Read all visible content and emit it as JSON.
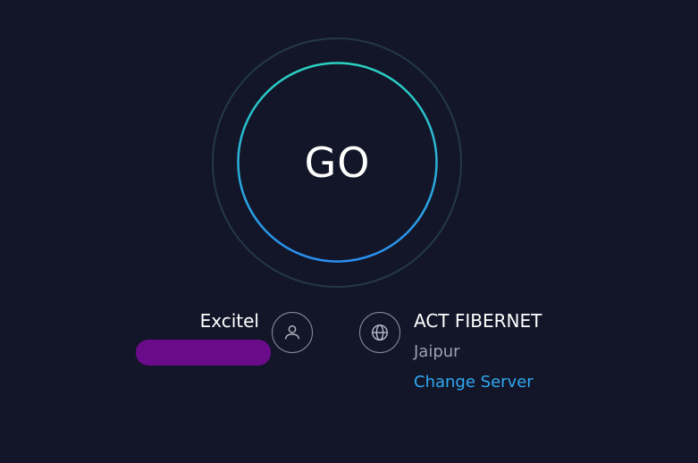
{
  "go_button": {
    "label": "GO"
  },
  "client": {
    "isp_name": "Excitel",
    "ip_redacted": true,
    "icon": "user-icon"
  },
  "server": {
    "name": "ACT FIBERNET",
    "location": "Jaipur",
    "change_label": "Change Server",
    "icon": "globe-icon"
  },
  "colors": {
    "background": "#131628",
    "ring_gradient_start": "#2ad1c0",
    "ring_gradient_end": "#2a8ff0",
    "outer_ring": "#233849",
    "link": "#2fa9f2",
    "redaction": "#6a0b8a"
  }
}
